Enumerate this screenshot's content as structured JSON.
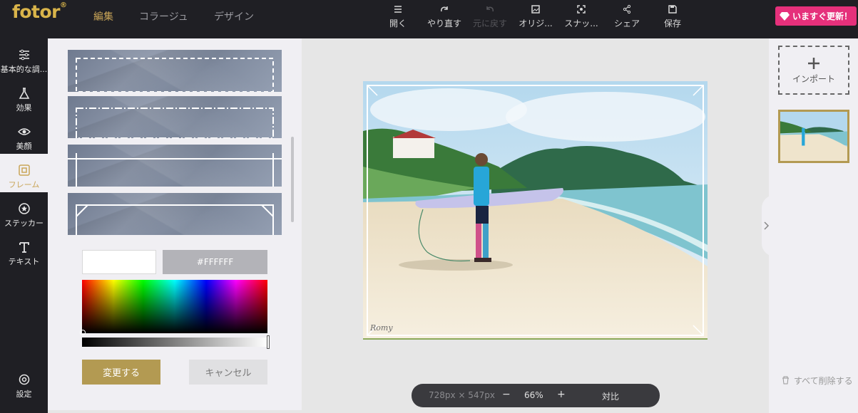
{
  "app": {
    "logo": "fotor",
    "logo_mark": "®"
  },
  "nav": {
    "tabs": [
      {
        "label": "編集",
        "active": true
      },
      {
        "label": "コラージュ"
      },
      {
        "label": "デザイン"
      }
    ]
  },
  "toolbar": {
    "open": "開く",
    "redo": "やり直す",
    "undo": "元に戻す",
    "original": "オリジ...",
    "snapshot": "スナッ...",
    "share": "シェア",
    "save": "保存"
  },
  "upgrade": {
    "label": "いますぐ更新！"
  },
  "sidebar": {
    "items": [
      {
        "label": "基本的な調...",
        "icon": "sliders-icon"
      },
      {
        "label": "効果",
        "icon": "flask-icon"
      },
      {
        "label": "美顔",
        "icon": "eye-icon"
      },
      {
        "label": "フレーム",
        "icon": "frame-icon",
        "active": true
      },
      {
        "label": "ステッカー",
        "icon": "star-icon"
      },
      {
        "label": "テキスト",
        "icon": "text-icon"
      }
    ],
    "settings": "設定"
  },
  "panel": {
    "hex": "#FFFFFF",
    "apply": "変更する",
    "cancel": "キャンセル"
  },
  "canvas": {
    "dimensions": "728px × 547px",
    "zoom": "66%",
    "zoom_out": "−",
    "zoom_in": "+",
    "compare": "対比",
    "watermark": "Romy"
  },
  "right": {
    "import": "インポート",
    "delete_all": "すべて削除する"
  },
  "colors": {
    "accent": "#c9a558",
    "upgrade": "#e5307b",
    "topbar": "#1f1f24"
  }
}
